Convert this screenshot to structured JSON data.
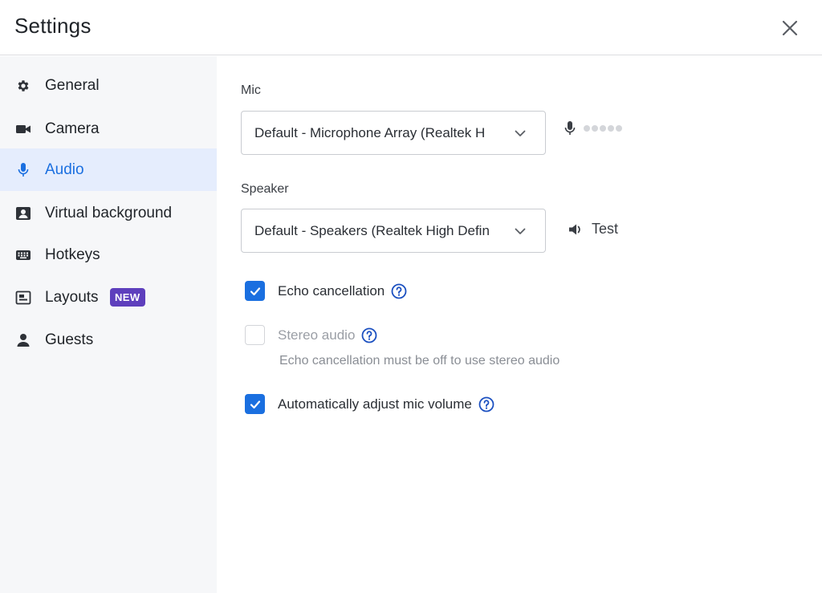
{
  "header": {
    "title": "Settings"
  },
  "sidebar": {
    "items": [
      {
        "label": "General",
        "icon": "gear-icon"
      },
      {
        "label": "Camera",
        "icon": "video-camera-icon"
      },
      {
        "label": "Audio",
        "icon": "microphone-icon",
        "active": true
      },
      {
        "label": "Virtual background",
        "icon": "portrait-icon"
      },
      {
        "label": "Hotkeys",
        "icon": "keyboard-icon"
      },
      {
        "label": "Layouts",
        "icon": "layout-icon",
        "badge": "NEW"
      },
      {
        "label": "Guests",
        "icon": "person-icon"
      }
    ]
  },
  "audio": {
    "mic": {
      "label": "Mic",
      "value": "Default - Microphone Array (Realtek H",
      "level_dots": 5
    },
    "speaker": {
      "label": "Speaker",
      "value": "Default - Speakers (Realtek High Defin",
      "test_label": "Test"
    },
    "options": [
      {
        "label": "Echo cancellation",
        "checked": true,
        "disabled": false
      },
      {
        "label": "Stereo audio",
        "checked": false,
        "disabled": true,
        "hint": "Echo cancellation must be off to use stereo audio"
      },
      {
        "label": "Automatically adjust mic volume",
        "checked": true,
        "disabled": false
      }
    ]
  },
  "colors": {
    "accent": "#1a6fe0",
    "badge": "#5e3fbd",
    "active_bg": "#e5edfd",
    "sidebar_bg": "#f6f7f9"
  }
}
